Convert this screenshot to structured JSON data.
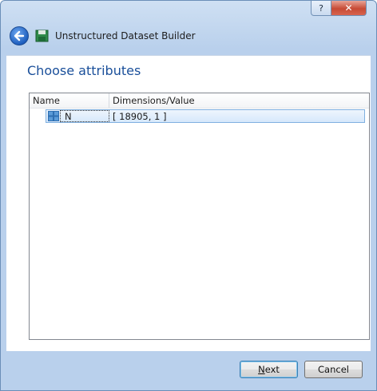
{
  "window": {
    "title": "Unstructured Dataset Builder",
    "help_glyph": "?",
    "close_glyph": "✕",
    "accent_color": "#1a4f9a"
  },
  "page": {
    "heading": "Choose attributes"
  },
  "tree": {
    "columns": [
      "Name",
      "Dimensions/Value"
    ],
    "rows": [
      {
        "name": "N",
        "value": "[ 18905, 1 ]",
        "icon": "grid-attribute-icon",
        "selected": true
      }
    ]
  },
  "footer": {
    "next_mnemonic": "N",
    "next_rest": "ext",
    "cancel_label": "Cancel"
  }
}
